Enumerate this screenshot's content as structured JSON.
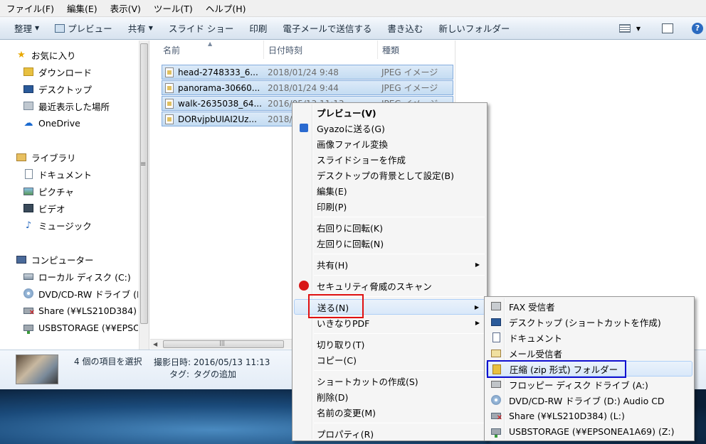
{
  "menubar": [
    "ファイル(F)",
    "編集(E)",
    "表示(V)",
    "ツール(T)",
    "ヘルプ(H)"
  ],
  "toolbar": {
    "organize": "整理",
    "preview": "プレビュー",
    "share": "共有",
    "slideshow": "スライド ショー",
    "print": "印刷",
    "email": "電子メールで送信する",
    "burn": "書き込む",
    "new_folder": "新しいフォルダー"
  },
  "nav": {
    "favorites": "お気に入り",
    "downloads": "ダウンロード",
    "desktop": "デスクトップ",
    "recent": "最近表示した場所",
    "onedrive": "OneDrive",
    "libraries": "ライブラリ",
    "documents": "ドキュメント",
    "pictures": "ピクチャ",
    "videos": "ビデオ",
    "music": "ミュージック",
    "computer": "コンピューター",
    "local_disk": "ローカル ディスク (C:)",
    "dvd": "DVD/CD-RW ドライブ (D",
    "share": "Share (¥¥LS210D384) (",
    "usb": "USBSTORAGE (¥¥EPSOI"
  },
  "columns": {
    "name": "名前",
    "date": "日付時刻",
    "type": "種類"
  },
  "files": [
    {
      "name": "head-2748333_6...",
      "date": "2018/01/24 9:48",
      "type": "JPEG イメージ"
    },
    {
      "name": "panorama-30660...",
      "date": "2018/01/24 9:44",
      "type": "JPEG イメージ"
    },
    {
      "name": "walk-2635038_64...",
      "date": "2016/05/13 11:13",
      "type": "JPEG イメージ"
    },
    {
      "name": "DORvjpbUIAI2Uz...",
      "date": "2018/",
      "type": ""
    }
  ],
  "details": {
    "count": "4 個の項目を選択",
    "date_label": "撮影日時: 2016/05/13 11:13",
    "tag_label": "タグ:",
    "tag_value": "タグの追加"
  },
  "context_menu": {
    "preview": "プレビュー(V)",
    "gyazo": "Gyazoに送る(G)",
    "convert": "画像ファイル変換",
    "slideshow": "スライドショーを作成",
    "set_bg": "デスクトップの背景として設定(B)",
    "edit": "編集(E)",
    "print": "印刷(P)",
    "rotate_right": "右回りに回転(K)",
    "rotate_left": "左回りに回転(N)",
    "share": "共有(H)",
    "security": "セキュリティ脅威のスキャン",
    "send_to": "送る(N)",
    "ikinari": "いきなりPDF",
    "cut": "切り取り(T)",
    "copy": "コピー(C)",
    "shortcut": "ショートカットの作成(S)",
    "delete": "削除(D)",
    "rename": "名前の変更(M)",
    "properties": "プロパティ(R)"
  },
  "send_to_menu": {
    "fax": "FAX 受信者",
    "desktop": "デスクトップ (ショートカットを作成)",
    "documents": "ドキュメント",
    "mail": "メール受信者",
    "zip": "圧縮 (zip 形式) フォルダー",
    "floppy": "フロッピー ディスク ドライブ (A:)",
    "dvd": "DVD/CD-RW ドライブ (D:) Audio CD",
    "share": "Share (¥¥LS210D384) (L:)",
    "usb": "USBSTORAGE (¥¥EPSONEA1A69) (Z:)"
  }
}
